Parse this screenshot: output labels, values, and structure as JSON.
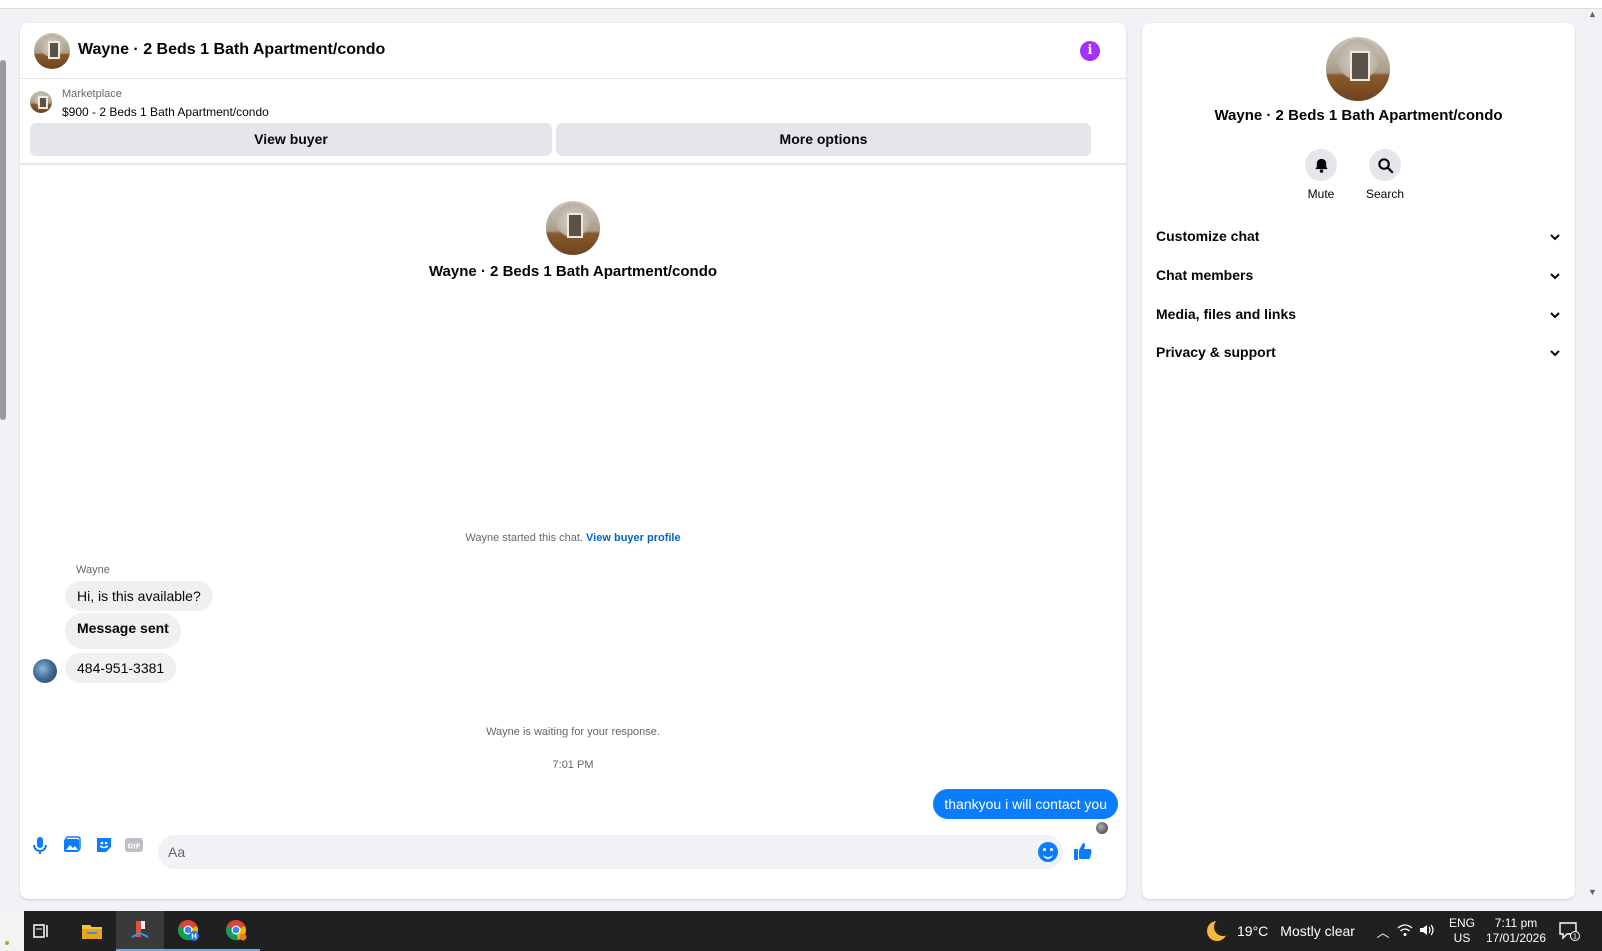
{
  "chat": {
    "title": "Wayne · 2 Beds 1 Bath Apartment/condo",
    "marketplace_label": "Marketplace",
    "listing": "$900 - 2 Beds 1 Bath Apartment/condo",
    "view_buyer_label": "View buyer",
    "more_options_label": "More options",
    "intro_name": "Wayne · 2 Beds 1 Bath Apartment/condo",
    "started_text": "Wayne started this chat.",
    "view_buyer_profile": "View buyer profile",
    "sender_name": "Wayne",
    "messages_in": [
      "Hi, is this available?",
      "Message sent",
      "484-951-3381"
    ],
    "waiting_text": "Wayne is waiting for your response.",
    "timestamp": "7:01 PM",
    "message_out": "thankyou i will contact you",
    "composer_placeholder": "Aa",
    "accent_color": "#0a7cff"
  },
  "info_panel": {
    "name": "Wayne · 2 Beds 1 Bath Apartment/condo",
    "mute_label": "Mute",
    "search_label": "Search",
    "sections": [
      "Customize chat",
      "Chat members",
      "Media, files and links",
      "Privacy & support"
    ]
  },
  "taskbar": {
    "weather_temp": "19°C",
    "weather_desc": "Mostly clear",
    "lang_top": "ENG",
    "lang_bottom": "US",
    "time": "7:11 pm",
    "date": "17/01/2026",
    "notification_count": "1"
  }
}
